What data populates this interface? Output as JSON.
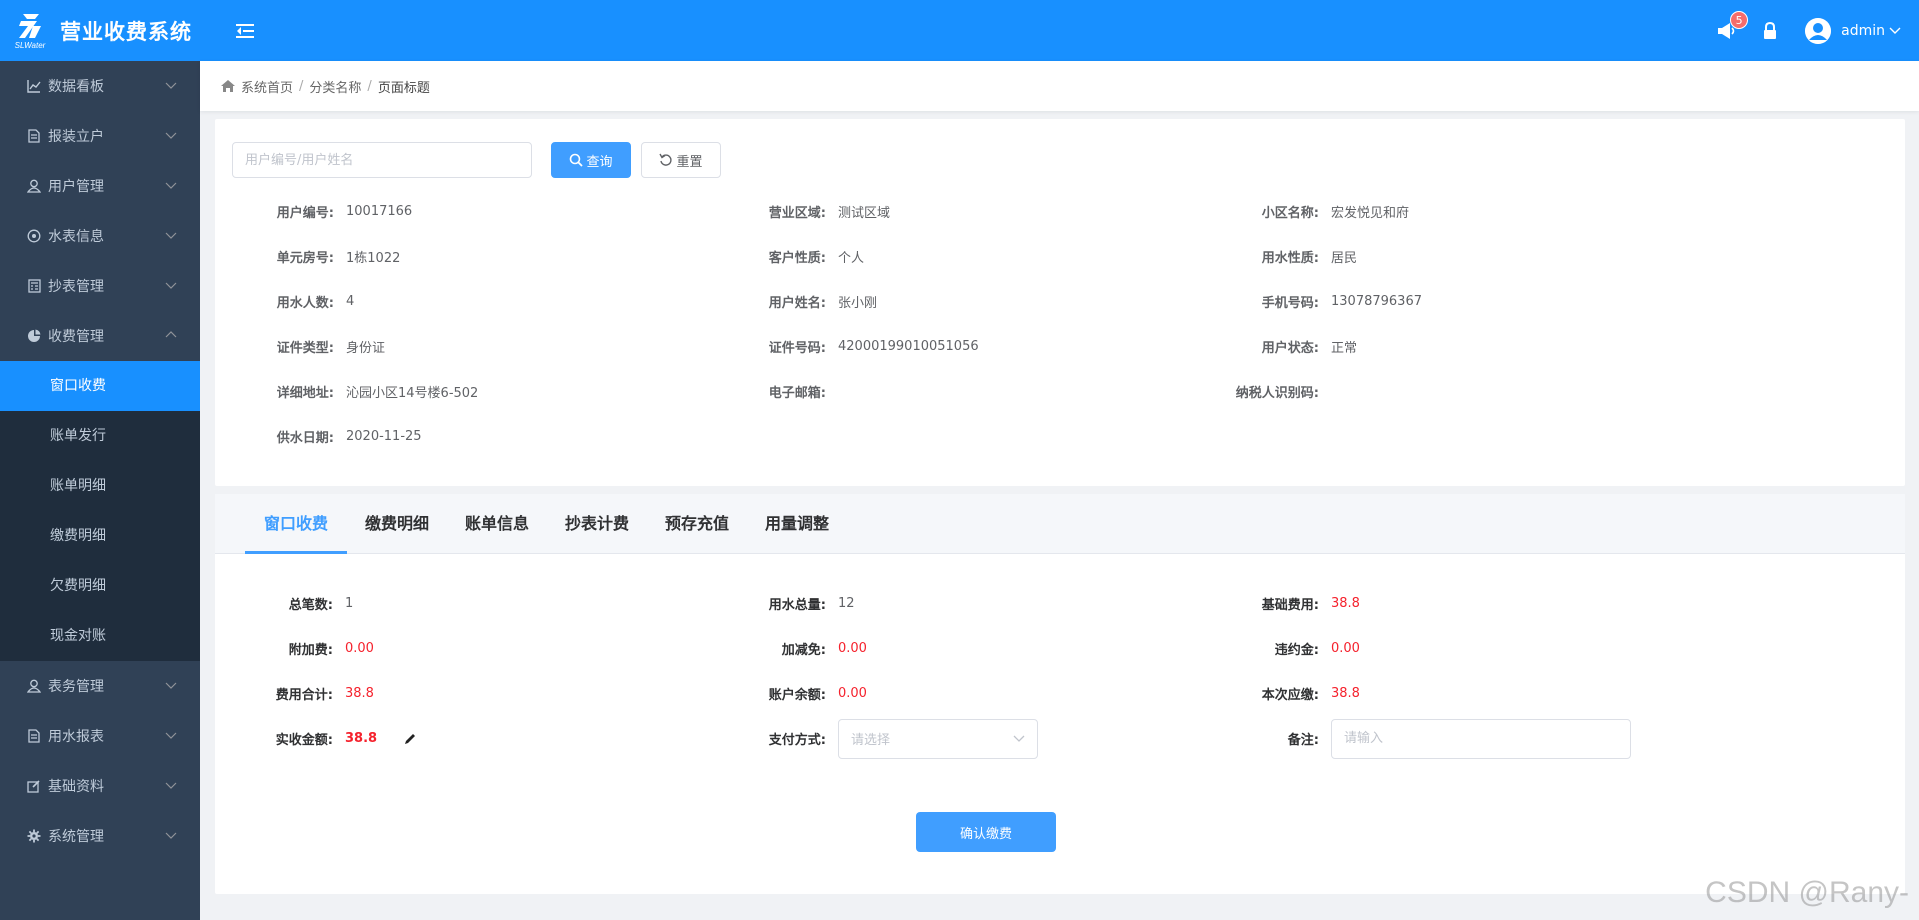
{
  "header": {
    "logo_sub": "SLWater",
    "app_title": "营业收费系统",
    "notification_count": "5",
    "username": "admin",
    "colors": {
      "primary": "#1890ff",
      "sidebar": "#304156",
      "submenu": "#1f2d3d",
      "danger": "#f5222d"
    }
  },
  "sidebar": {
    "items": [
      {
        "label": "数据看板",
        "icon": "chart-icon"
      },
      {
        "label": "报装立户",
        "icon": "document-icon"
      },
      {
        "label": "用户管理",
        "icon": "user-icon"
      },
      {
        "label": "水表信息",
        "icon": "meter-icon"
      },
      {
        "label": "抄表管理",
        "icon": "calculator-icon"
      },
      {
        "label": "收费管理",
        "icon": "pie-chart-icon",
        "expanded": true
      },
      {
        "label": "表务管理",
        "icon": "user-icon"
      },
      {
        "label": "用水报表",
        "icon": "document-icon"
      },
      {
        "label": "基础资料",
        "icon": "edit-icon"
      },
      {
        "label": "系统管理",
        "icon": "gear-icon"
      }
    ],
    "sub_items": [
      "窗口收费",
      "账单发行",
      "账单明细",
      "缴费明细",
      "欠费明细",
      "现金对账"
    ],
    "active_sub": "窗口收费"
  },
  "breadcrumb": {
    "home": "系统首页",
    "category": "分类名称",
    "page": "页面标题"
  },
  "search": {
    "placeholder": "用户编号/用户姓名",
    "query_label": "查询",
    "reset_label": "重置"
  },
  "user_info": [
    [
      {
        "label": "用户编号:",
        "value": "10017166"
      },
      {
        "label": "营业区域:",
        "value": "测试区域"
      },
      {
        "label": "小区名称:",
        "value": "宏发悦见和府"
      }
    ],
    [
      {
        "label": "单元房号:",
        "value": "1栋1022"
      },
      {
        "label": "客户性质:",
        "value": "个人"
      },
      {
        "label": "用水性质:",
        "value": "居民"
      }
    ],
    [
      {
        "label": "用水人数:",
        "value": "4"
      },
      {
        "label": "用户姓名:",
        "value": "张小刚"
      },
      {
        "label": "手机号码:",
        "value": "13078796367"
      }
    ],
    [
      {
        "label": "证件类型:",
        "value": "身份证"
      },
      {
        "label": "证件号码:",
        "value": "42000199010051056"
      },
      {
        "label": "用户状态:",
        "value": "正常"
      }
    ],
    [
      {
        "label": "详细地址:",
        "value": "沁园小区14号楼6-502"
      },
      {
        "label": "电子邮箱:",
        "value": ""
      },
      {
        "label": "纳税人识别码:",
        "value": ""
      }
    ],
    [
      {
        "label": "供水日期:",
        "value": "2020-11-25"
      }
    ]
  ],
  "tabs": [
    "窗口收费",
    "缴费明细",
    "账单信息",
    "抄表计费",
    "预存充值",
    "用量调整"
  ],
  "fees": {
    "total_count_label": "总笔数:",
    "total_count": "1",
    "water_total_label": "用水总量:",
    "water_total": "12",
    "base_fee_label": "基础费用:",
    "base_fee": "38.8",
    "extra_fee_label": "附加费:",
    "extra_fee": "0.00",
    "discount_label": "加减免:",
    "discount": "0.00",
    "penalty_label": "违约金:",
    "penalty": "0.00",
    "fee_total_label": "费用合计:",
    "fee_total": "38.8",
    "balance_label": "账户余额:",
    "balance": "0.00",
    "due_label": "本次应缴:",
    "due": "38.8",
    "received_label": "实收金额:",
    "received": "38.8",
    "payment_method_label": "支付方式:",
    "payment_method_placeholder": "请选择",
    "remark_label": "备注:",
    "remark_placeholder": "请输入"
  },
  "confirm_label": "确认缴费",
  "watermark": "CSDN @Rany-"
}
